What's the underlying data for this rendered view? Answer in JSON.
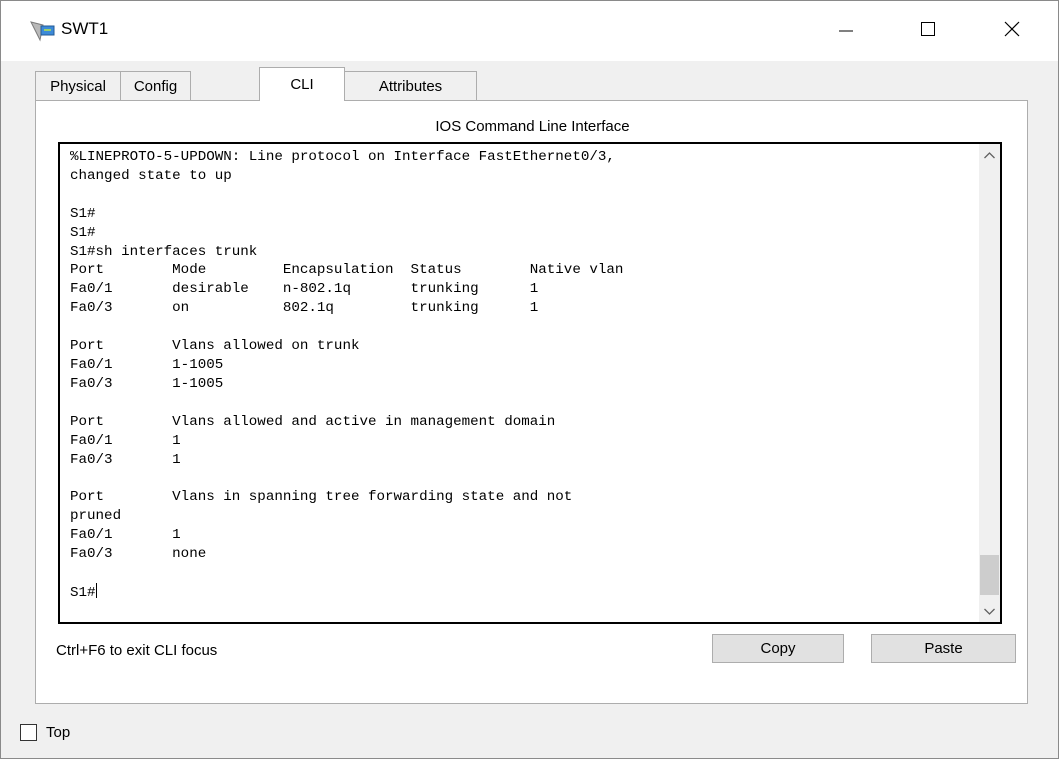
{
  "window": {
    "title": "SWT1"
  },
  "tabs": [
    {
      "label": "Physical",
      "active": false
    },
    {
      "label": "Config",
      "active": false
    },
    {
      "label": "CLI",
      "active": true
    },
    {
      "label": "Attributes",
      "active": false
    }
  ],
  "cli": {
    "heading": "IOS Command Line Interface",
    "lines": [
      "%LINEPROTO-5-UPDOWN: Line protocol on Interface FastEthernet0/3,",
      "changed state to up",
      "",
      "S1#",
      "S1#",
      "S1#sh interfaces trunk",
      "Port        Mode         Encapsulation  Status        Native vlan",
      "Fa0/1       desirable    n-802.1q       trunking      1",
      "Fa0/3       on           802.1q         trunking      1",
      "",
      "Port        Vlans allowed on trunk",
      "Fa0/1       1-1005",
      "Fa0/3       1-1005",
      "",
      "Port        Vlans allowed and active in management domain",
      "Fa0/1       1",
      "Fa0/3       1",
      "",
      "Port        Vlans in spanning tree forwarding state and not",
      "pruned",
      "Fa0/1       1",
      "Fa0/3       none",
      ""
    ],
    "prompt": "S1#"
  },
  "footer": {
    "hint": "Ctrl+F6 to exit CLI focus",
    "copy_label": "Copy",
    "paste_label": "Paste"
  },
  "top_option": {
    "label": "Top",
    "checked": false
  }
}
